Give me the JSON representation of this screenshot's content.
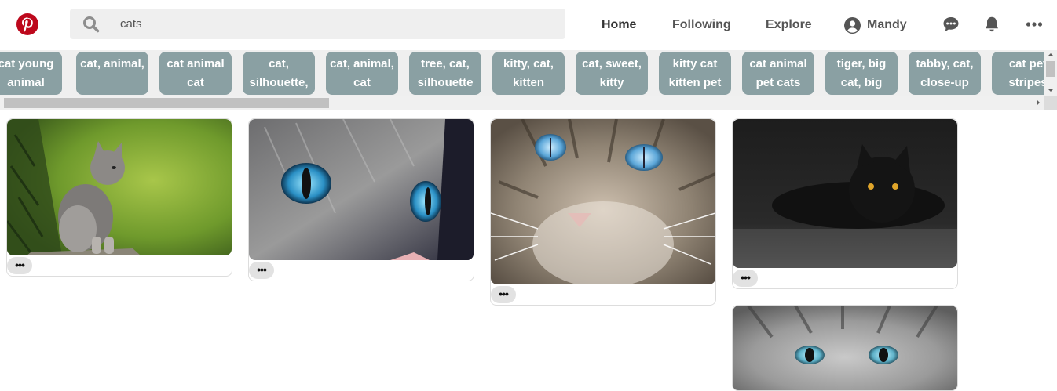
{
  "header": {
    "logo_icon": "pinterest-logo-icon",
    "search": {
      "value": "cats",
      "icon": "search-icon"
    },
    "nav": {
      "home": "Home",
      "following": "Following",
      "explore": "Explore",
      "user_name": "Mandy"
    },
    "icons": [
      "user-avatar-icon",
      "chat-icon",
      "bell-icon",
      "more-horizontal-icon"
    ]
  },
  "tags": [
    "cat young animal",
    "cat, animal,",
    "cat animal cat",
    "cat, silhouette,",
    "cat, animal, cat",
    "tree, cat, silhouette",
    "kitty, cat, kitten",
    "cat, sweet, kitty",
    "kitty cat kitten pet",
    "cat animal pet cats",
    "tiger, big cat, big",
    "tabby, cat, close-up",
    "cat pet stripes"
  ],
  "pins": [
    {
      "subject": "kitten sitting on a tree branch",
      "more_label": "•••"
    },
    {
      "subject": "cat blue eye close-up",
      "more_label": "•••"
    },
    {
      "subject": "tabby cat face blue eyes",
      "more_label": "•••"
    },
    {
      "subject": "black cat lying in the dark",
      "more_label": "•••"
    },
    {
      "subject": "grey cat face blue eyes",
      "more_label": ""
    }
  ],
  "colors": {
    "brand_red": "#bd081c",
    "tag_bg": "#8aa0a3",
    "search_bg": "#efefef"
  }
}
